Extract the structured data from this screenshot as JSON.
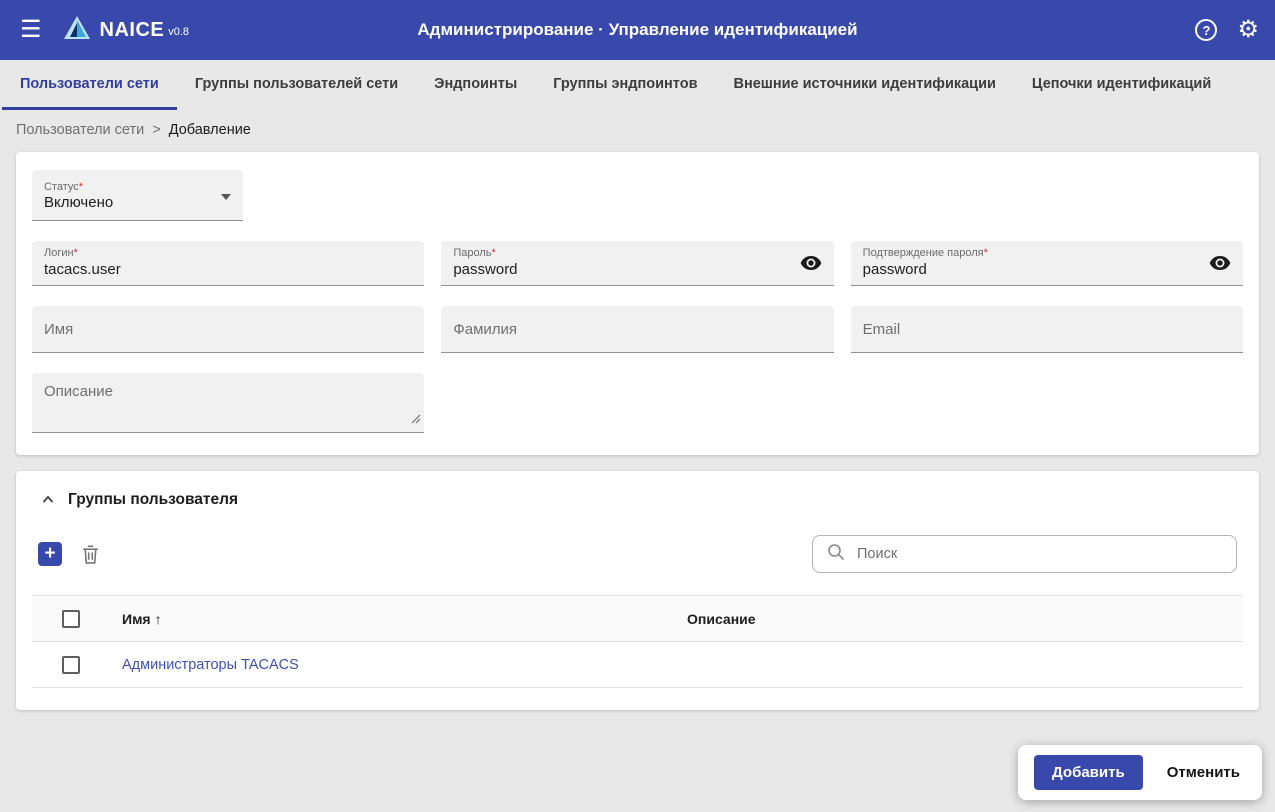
{
  "colors": {
    "primary": "#3949ab",
    "active_tab": "#303f9f",
    "link": "#3f51b5",
    "required": "#d32f2f"
  },
  "icons": {
    "menu": "☰",
    "gear": "⚙",
    "help": "?",
    "add": "+"
  },
  "header": {
    "app_name": "NAICE",
    "version": "v0.8",
    "title": "Администрирование · Управление идентификацией"
  },
  "tabs": [
    {
      "label": "Пользователи сети"
    },
    {
      "label": "Группы пользователей сети"
    },
    {
      "label": "Эндпоинты"
    },
    {
      "label": "Группы эндпоинтов"
    },
    {
      "label": "Внешние источники идентификации"
    },
    {
      "label": "Цепочки идентификаций"
    }
  ],
  "breadcrumb": {
    "parent": "Пользователи сети",
    "separator": ">",
    "current": "Добавление"
  },
  "form": {
    "required_marker": "*",
    "status": {
      "label": "Статус",
      "value": "Включено"
    },
    "login": {
      "label": "Логин",
      "value": "tacacs.user"
    },
    "password": {
      "label": "Пароль",
      "value": "password"
    },
    "password_confirm": {
      "label": "Подтверждение пароля",
      "value": "password"
    },
    "first_name": {
      "placeholder": "Имя"
    },
    "last_name": {
      "placeholder": "Фамилия"
    },
    "email": {
      "placeholder": "Email"
    },
    "description": {
      "placeholder": "Описание"
    }
  },
  "groups": {
    "title": "Группы пользователя",
    "search_placeholder": "Поиск",
    "table": {
      "col_name": "Имя",
      "sort_arrow": "↑",
      "col_description": "Описание",
      "rows": [
        {
          "name": "Администраторы TACACS",
          "description": ""
        }
      ]
    }
  },
  "actions": {
    "submit": "Добавить",
    "cancel": "Отменить"
  }
}
